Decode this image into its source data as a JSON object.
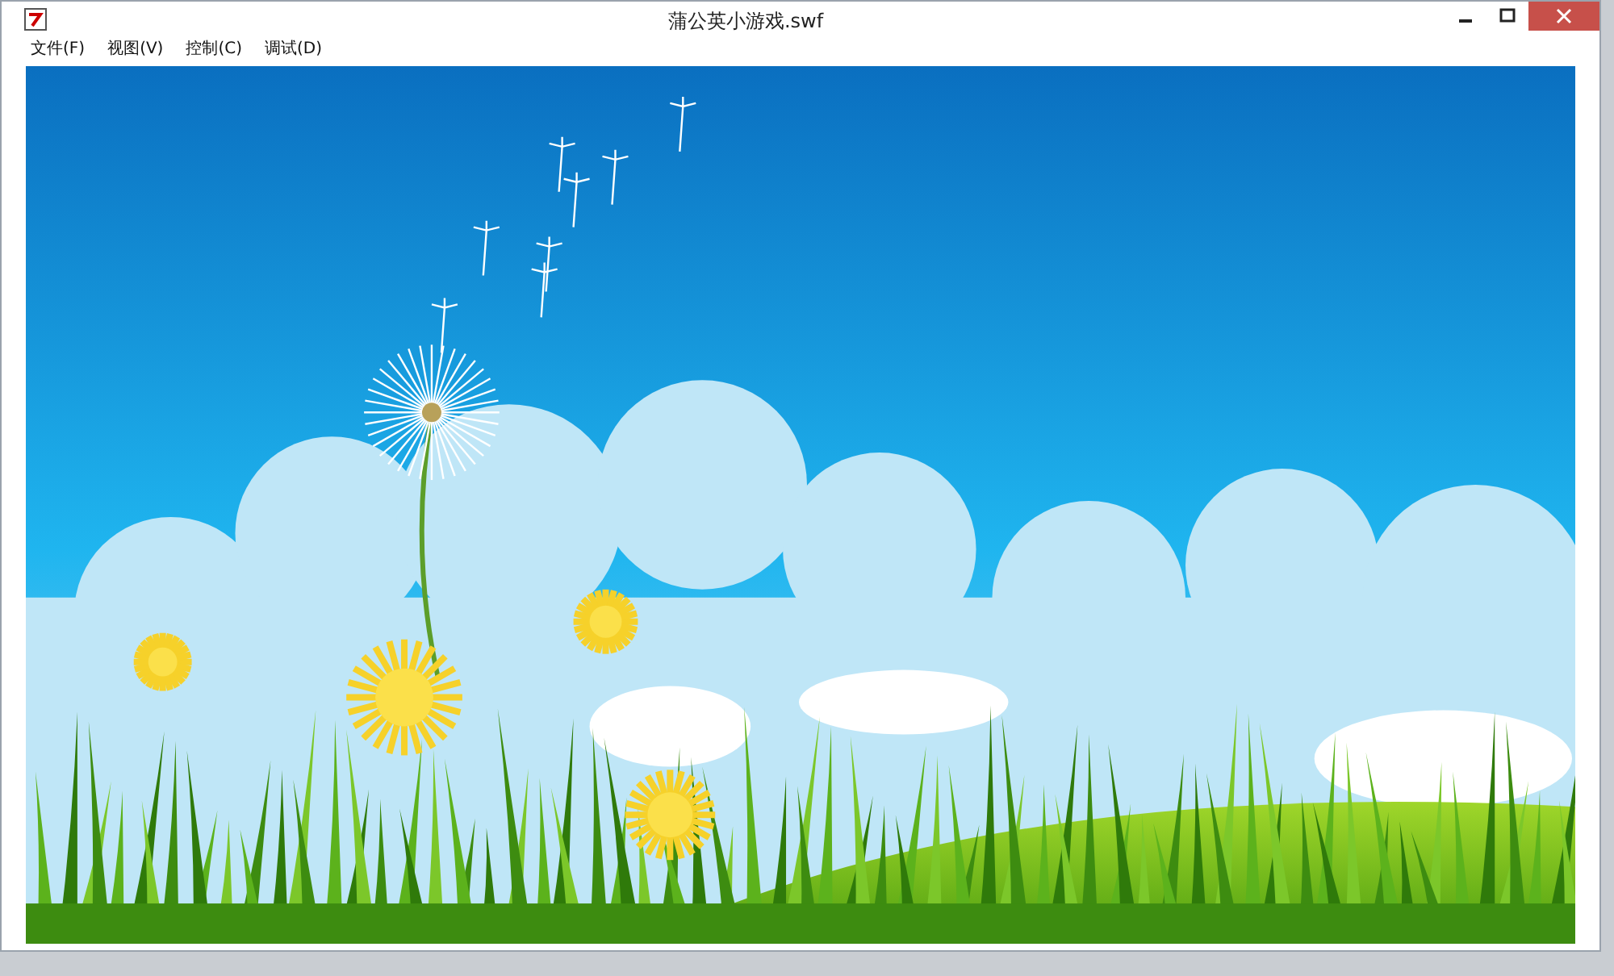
{
  "window": {
    "title": "蒲公英小游戏.swf"
  },
  "menu": [
    {
      "label": "文件(F)"
    },
    {
      "label": "视图(V)"
    },
    {
      "label": "控制(C)"
    },
    {
      "label": "调试(D)"
    }
  ]
}
